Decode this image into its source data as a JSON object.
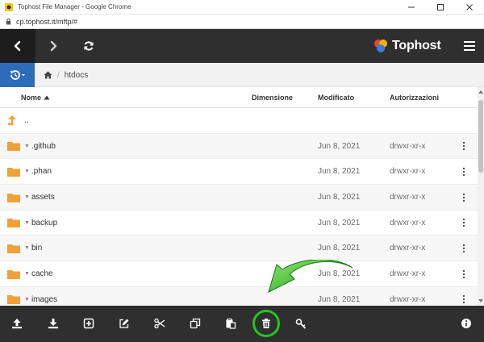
{
  "browser": {
    "window_title": "Tophost File Manager - Google Chrome",
    "url": "cp.tophost.it/mftp/#"
  },
  "app": {
    "logo_text": "Tophost",
    "breadcrumb": {
      "home_icon": "home-icon",
      "path": "htdocs"
    }
  },
  "table": {
    "headers": {
      "name": "Nome",
      "size": "Dimensione",
      "modified": "Modificato",
      "permissions": "Autorizzazioni"
    },
    "parent_label": "..",
    "rows": [
      {
        "name": ".github",
        "date": "Jun 8, 2021",
        "perm": "drwxr-xr-x"
      },
      {
        "name": ".phan",
        "date": "Jun 8, 2021",
        "perm": "drwxr-xr-x"
      },
      {
        "name": "assets",
        "date": "Jun 8, 2021",
        "perm": "drwxr-xr-x"
      },
      {
        "name": "backup",
        "date": "Jun 8, 2021",
        "perm": "drwxr-xr-x"
      },
      {
        "name": "bin",
        "date": "Jun 8, 2021",
        "perm": "drwxr-xr-x"
      },
      {
        "name": "cache",
        "date": "Jun 8, 2021",
        "perm": "drwxr-xr-x"
      },
      {
        "name": "images",
        "date": "Jun 8, 2021",
        "perm": "drwxr-xr-x"
      }
    ]
  },
  "toolbar_icons": [
    "upload-icon",
    "download-icon",
    "new-folder-icon",
    "rename-icon",
    "cut-icon",
    "copy-icon",
    "paste-icon",
    "delete-icon",
    "permissions-key-icon",
    "info-icon"
  ],
  "colors": {
    "header_dark": "#2f2f2f",
    "accent_blue": "#2d6bbb",
    "folder_orange": "#f0a13a",
    "highlight_green": "#22c51e"
  }
}
